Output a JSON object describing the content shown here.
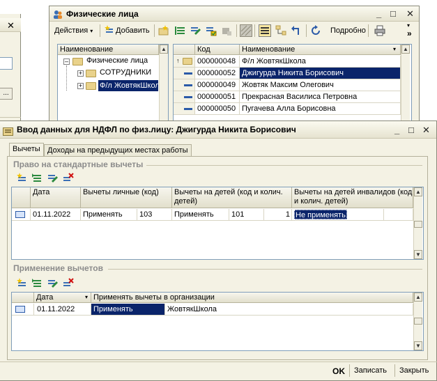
{
  "left_window": {
    "close_glyph": "✕",
    "button_label": "..."
  },
  "persons_window": {
    "title": "Физические лица",
    "controls": {
      "minimize": "_",
      "maximize": "□",
      "close": "✕"
    },
    "toolbar": {
      "actions_label": "Действия",
      "add_label": "Добавить",
      "podrobno_label": "Подробно",
      "more_glyph": "»"
    },
    "tree": {
      "header": "Наименование",
      "root": "Физические лица",
      "children": [
        "СОТРУДНИКИ",
        "Ф/л ЖовтякШкола"
      ]
    },
    "list": {
      "col_code": "Код",
      "col_name": "Наименование",
      "rows": [
        {
          "code": "000000048",
          "name": "Ф/л ЖовтякШкола",
          "kind": "folder"
        },
        {
          "code": "000000052",
          "name": "Джигурда Никита Борисович",
          "kind": "item"
        },
        {
          "code": "000000049",
          "name": "Жовтяк Максим Олегович",
          "kind": "item"
        },
        {
          "code": "000000051",
          "name": "Прекрасная Василиса Петровна",
          "kind": "item"
        },
        {
          "code": "000000050",
          "name": "Пугачева Алла Борисовна",
          "kind": "item"
        }
      ]
    }
  },
  "ndfl_window": {
    "title": "Ввод данных для НДФЛ по физ.лицу: Джигурда Никита Борисович",
    "controls": {
      "minimize": "_",
      "maximize": "□",
      "close": "✕"
    },
    "tabs": [
      "Вычеты",
      "Доходы на предыдущих местах работы"
    ],
    "section1": {
      "title": "Право на стандартные вычеты",
      "headers": {
        "date": "Дата",
        "personal": "Вычеты личные (код)",
        "children": "Вычеты на детей (код и колич. детей)",
        "disabled": "Вычеты на детей инвалидов (код и колич. детей)"
      },
      "row": {
        "date": "01.11.2022",
        "personal_apply": "Применять",
        "personal_code": "103",
        "children_apply": "Применять",
        "children_code": "101",
        "children_count": "1",
        "disabled_apply": "Не применять"
      }
    },
    "section2": {
      "title": "Применение вычетов",
      "headers": {
        "date": "Дата",
        "org": "Применять вычеты в организации"
      },
      "row": {
        "date": "01.11.2022",
        "apply": "Применять",
        "org": "ЖовтякШкола"
      }
    },
    "footer": {
      "ok": "OK",
      "save": "Записать",
      "close": "Закрыть"
    }
  },
  "colors": {
    "selection": "#0a246a",
    "window_bg": "#f4f2e4",
    "section_title": "#8c8c8c"
  }
}
